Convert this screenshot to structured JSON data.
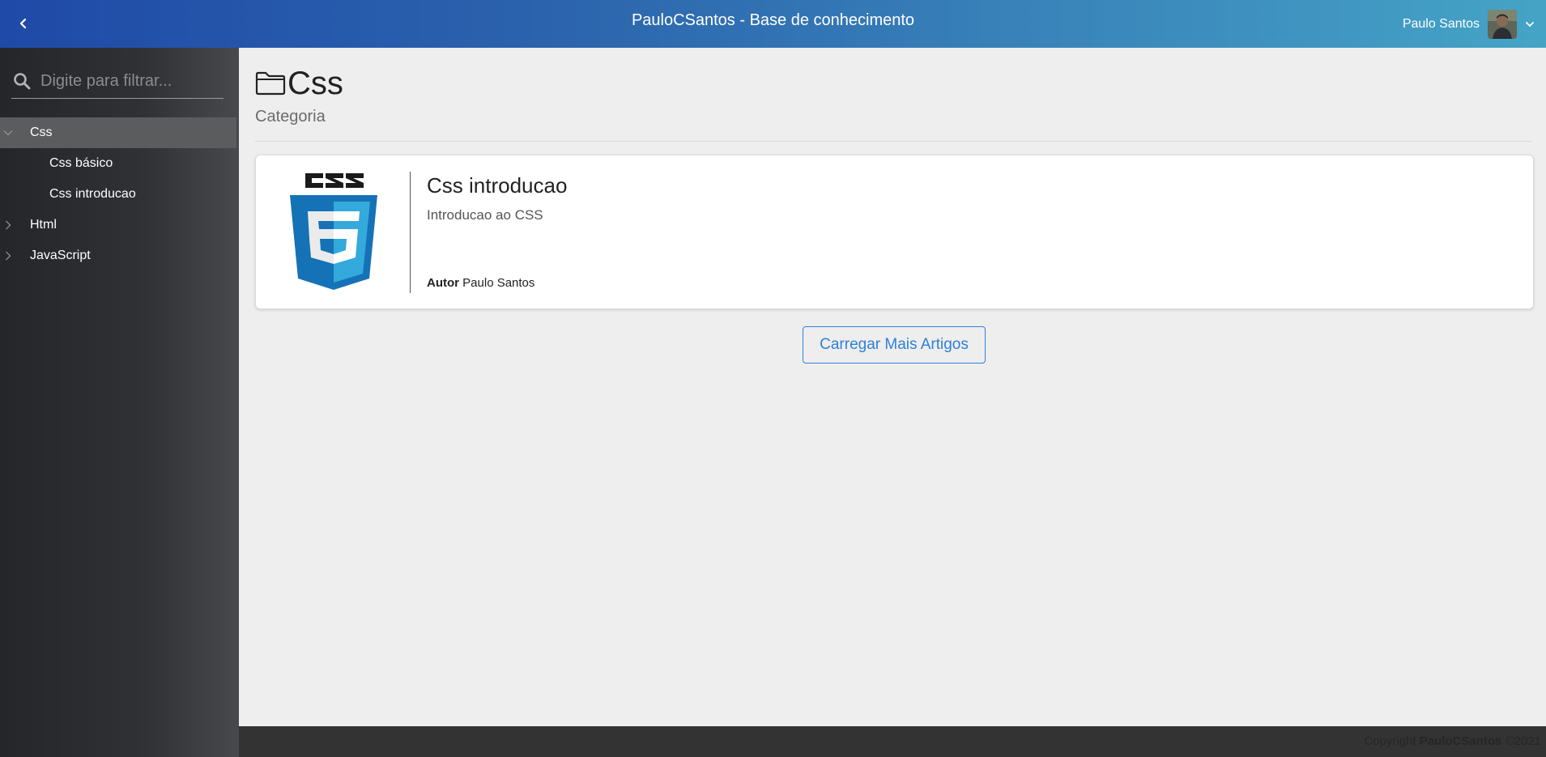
{
  "header": {
    "title": "PauloCSantos - Base de conhecimento",
    "user_name": "Paulo Santos"
  },
  "sidebar": {
    "search_placeholder": "Digite para filtrar...",
    "tree": [
      {
        "label": "Css",
        "expanded": true,
        "selected": true
      },
      {
        "label": "Css básico",
        "level": 2
      },
      {
        "label": "Css introducao",
        "level": 2
      },
      {
        "label": "Html",
        "expanded": false
      },
      {
        "label": "JavaScript",
        "expanded": false
      }
    ]
  },
  "main": {
    "title": "Css",
    "subtitle": "Categoria",
    "articles": [
      {
        "name": "Css introducao",
        "description": "Introducao ao CSS",
        "author_label": "Autor",
        "author": "Paulo Santos",
        "logo": "css3-logo"
      }
    ],
    "load_more_label": "Carregar Mais Artigos"
  },
  "footer": {
    "prefix": "Copyright",
    "brand": "PauloCSantos",
    "suffix": "©2021"
  },
  "colors": {
    "header_start": "#1f4aa8",
    "header_end": "#45a4c6",
    "accent": "#2f80d8"
  }
}
